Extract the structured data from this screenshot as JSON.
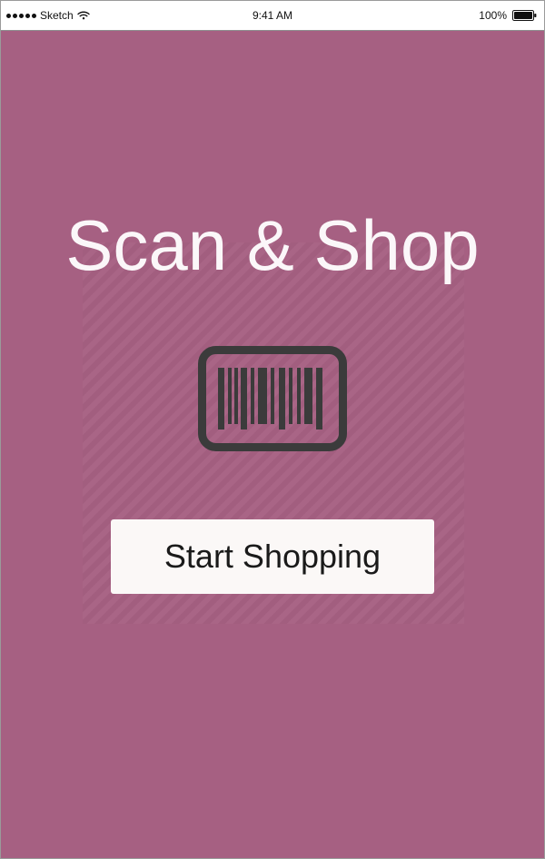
{
  "status_bar": {
    "carrier": "Sketch",
    "time": "9:41 AM",
    "battery_percent": "100%"
  },
  "screen": {
    "background_color": "#a66082",
    "title": "Scan & Shop",
    "icon": "barcode-icon",
    "primary_button": {
      "label": "Start Shopping"
    }
  }
}
